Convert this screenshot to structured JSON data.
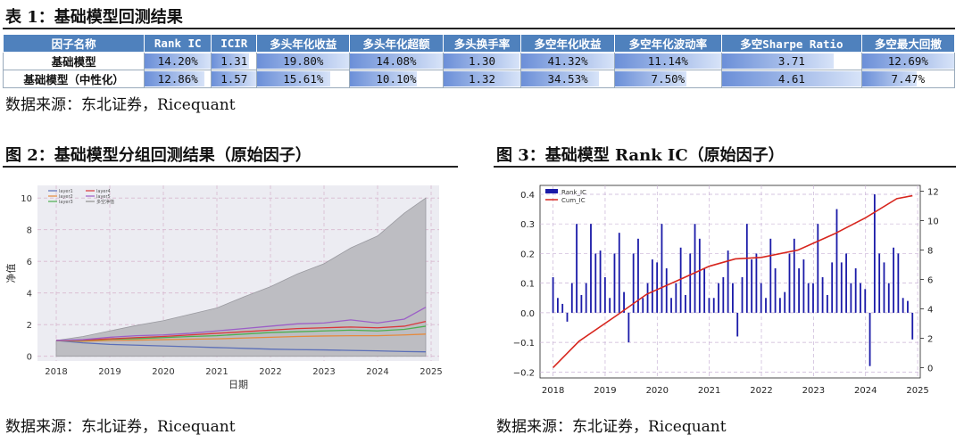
{
  "table1": {
    "title": "表 1：基础模型回测结果",
    "headers": [
      "因子名称",
      "Rank IC",
      "ICIR",
      "多头年化收益",
      "多头年化超额",
      "多头换手率",
      "多空年化收益",
      "多空年化波动率",
      "多空Sharpe Ratio",
      "多空最大回撤"
    ],
    "rows": [
      {
        "name": "基础模型",
        "cells": [
          "14.20%",
          "1.31",
          "19.80%",
          "14.08%",
          "1.30",
          "41.32%",
          "11.14%",
          "3.71",
          "12.69%"
        ],
        "fill": [
          1.0,
          0.83,
          1.0,
          1.0,
          0.98,
          1.0,
          1.0,
          0.8,
          1.0
        ]
      },
      {
        "name": "基础模型（中性化）",
        "cells": [
          "12.86%",
          "1.57",
          "15.61%",
          "10.10%",
          "1.32",
          "34.53%",
          "7.50%",
          "4.61",
          "7.47%"
        ],
        "fill": [
          0.9,
          1.0,
          0.79,
          0.72,
          1.0,
          0.84,
          0.67,
          1.0,
          0.59
        ]
      }
    ],
    "source": "数据来源：东北证券，Ricequant"
  },
  "fig2": {
    "title": "图 2：基础模型分组回测结果（原始因子）",
    "source": "数据来源：东北证券，Ricequant",
    "chart_data": {
      "type": "area",
      "xlabel": "日期",
      "ylabel": "净值",
      "x_ticks": [
        "2018",
        "2019",
        "2020",
        "2021",
        "2022",
        "2023",
        "2024",
        "2025"
      ],
      "y_ticks": [
        0,
        2,
        4,
        6,
        8,
        10
      ],
      "ylim": [
        -0.3,
        10.8
      ],
      "legend": [
        "layer1",
        "layer2",
        "layer3",
        "layer4",
        "layer5",
        "多空净值"
      ],
      "legend_position": "top-left",
      "grid": true,
      "x": [
        2018.0,
        2018.5,
        2019.0,
        2019.5,
        2020.0,
        2020.5,
        2021.0,
        2021.5,
        2022.0,
        2022.5,
        2023.0,
        2023.5,
        2024.0,
        2024.5,
        2024.9
      ],
      "series": [
        {
          "name": "layer1",
          "color": "#5b6fb8",
          "values": [
            1.0,
            0.85,
            0.75,
            0.7,
            0.65,
            0.6,
            0.55,
            0.5,
            0.45,
            0.42,
            0.4,
            0.37,
            0.34,
            0.3,
            0.28
          ]
        },
        {
          "name": "layer2",
          "color": "#e58a3c",
          "values": [
            1.0,
            0.95,
            1.0,
            1.02,
            1.05,
            1.08,
            1.1,
            1.15,
            1.2,
            1.25,
            1.28,
            1.3,
            1.3,
            1.35,
            1.4
          ]
        },
        {
          "name": "layer3",
          "color": "#4caf50",
          "values": [
            1.0,
            1.0,
            1.08,
            1.12,
            1.18,
            1.25,
            1.3,
            1.4,
            1.5,
            1.55,
            1.6,
            1.65,
            1.6,
            1.7,
            1.9
          ]
        },
        {
          "name": "layer4",
          "color": "#d9373b",
          "values": [
            1.0,
            1.02,
            1.1,
            1.18,
            1.25,
            1.35,
            1.45,
            1.55,
            1.65,
            1.75,
            1.8,
            1.85,
            1.8,
            1.9,
            2.2
          ]
        },
        {
          "name": "layer5",
          "color": "#9c5fc7",
          "values": [
            1.0,
            1.05,
            1.2,
            1.3,
            1.35,
            1.45,
            1.6,
            1.75,
            1.9,
            2.05,
            2.1,
            2.3,
            2.1,
            2.35,
            3.1
          ]
        },
        {
          "name": "多空净值",
          "color": "#8e8e8e",
          "values": [
            1.0,
            1.25,
            1.6,
            1.95,
            2.25,
            2.65,
            3.05,
            3.75,
            4.4,
            5.2,
            5.85,
            6.85,
            7.6,
            9.05,
            10.0
          ]
        }
      ]
    }
  },
  "fig3": {
    "title": "图 3：基础模型 Rank IC（原始因子）",
    "source": "数据来源：东北证券，Ricequant",
    "chart_data": {
      "type": "bar",
      "left_y_ticks": [
        "0.4",
        "0.3",
        "0.2",
        "0.1",
        "0.0",
        "−0.1",
        "−0.2"
      ],
      "right_y_ticks": [
        "12",
        "10",
        "8",
        "6",
        "4",
        "2",
        "0"
      ],
      "x_ticks": [
        "2018",
        "2019",
        "2020",
        "2021",
        "2022",
        "2023",
        "2024",
        "2025"
      ],
      "ylim_left": [
        -0.22,
        0.43
      ],
      "ylim_right": [
        -0.7,
        12.4
      ],
      "legend": [
        "Rank_IC",
        "Cum_IC"
      ],
      "legend_position": "top-left",
      "grid": true,
      "bar_color": "#1a1aa8",
      "line_color": "#d7261e",
      "series": [
        {
          "name": "Rank_IC",
          "values": [
            0.12,
            0.05,
            0.03,
            -0.03,
            0.1,
            0.3,
            0.06,
            0.1,
            0.3,
            0.2,
            0.21,
            0.12,
            0.05,
            0.2,
            0.27,
            0.07,
            -0.1,
            0.2,
            0.25,
            0.05,
            0.1,
            0.18,
            0.17,
            0.3,
            0.15,
            0.05,
            0.1,
            0.22,
            0.06,
            0.2,
            0.3,
            0.25,
            0.15,
            0.05,
            0.05,
            0.1,
            0.12,
            0.21,
            0.1,
            -0.08,
            0.12,
            0.3,
            0.18,
            0.2,
            0.1,
            0.05,
            0.25,
            0.15,
            0.05,
            0.07,
            0.2,
            0.25,
            0.15,
            0.18,
            0.1,
            0.1,
            0.3,
            0.12,
            0.06,
            0.17,
            0.35,
            0.17,
            0.2,
            0.1,
            0.15,
            0.1,
            0.08,
            -0.18,
            0.4,
            0.2,
            0.17,
            0.1,
            0.22,
            0.2,
            0.05,
            0.04,
            -0.09
          ]
        },
        {
          "name": "Cum_IC",
          "values": [
            0.0,
            1.8,
            3.5,
            5.0,
            6.1,
            6.9,
            7.4,
            7.5,
            8.0,
            9.1,
            10.2,
            11.5,
            11.7
          ]
        }
      ],
      "cum_x": [
        2018.0,
        2018.5,
        2019.2,
        2019.8,
        2020.5,
        2021.0,
        2021.5,
        2022.0,
        2022.7,
        2023.4,
        2024.0,
        2024.6,
        2024.9
      ]
    }
  }
}
